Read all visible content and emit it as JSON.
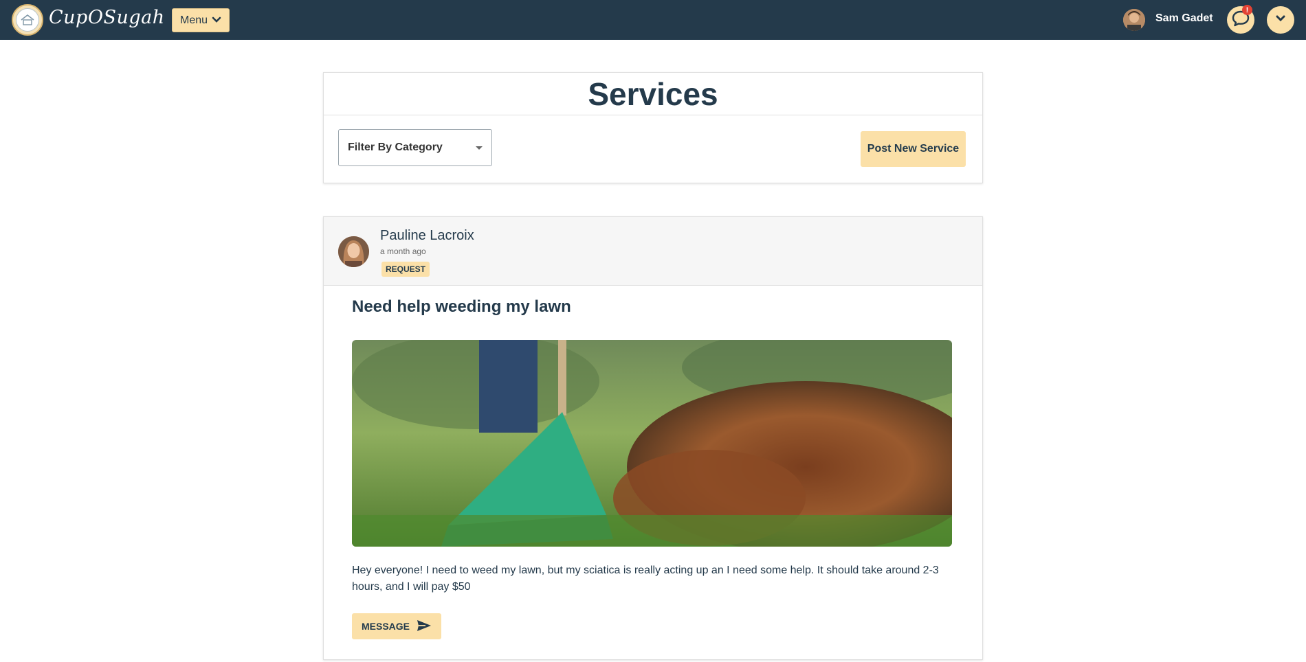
{
  "navbar": {
    "brand": "CupOSugah",
    "menu_label": "Menu",
    "username": "Sam Gadet",
    "notification_badge": "!"
  },
  "services": {
    "title": "Services",
    "filter_placeholder": "Filter By Category",
    "post_button": "Post New Service"
  },
  "posts": [
    {
      "author": "Pauline Lacroix",
      "time": "a month ago",
      "type_badge": "REQUEST",
      "title": "Need help weeding my lawn",
      "body": "Hey everyone! I need to weed my lawn, but my sciatica is really acting up an I need some help. It should take around 2-3 hours, and I will pay $50",
      "message_button": "MESSAGE"
    }
  ],
  "colors": {
    "navbar_bg": "#243a4b",
    "accent": "#fbe0a8",
    "text": "#233b4d",
    "badge_red": "#e34234"
  },
  "icons": {
    "menu_chevron": "chevron-down-icon",
    "chat": "chat-bubble-icon",
    "profile_menu": "chevron-down-icon",
    "message_send": "send-icon"
  }
}
